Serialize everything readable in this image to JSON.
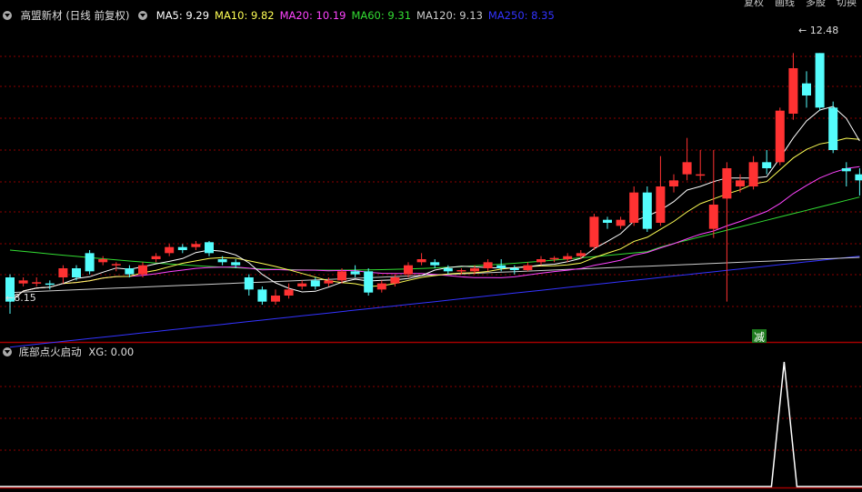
{
  "toolbar": {
    "right_buttons": [
      "复权",
      "画线",
      "多股",
      "切换"
    ]
  },
  "stock": {
    "name": "高盟新材",
    "period": "(日线 前复权)"
  },
  "ma_legend": [
    {
      "label": "MA5:",
      "value": "9.29",
      "color": "#ffffff"
    },
    {
      "label": "MA10:",
      "value": "9.82",
      "color": "#ffff55"
    },
    {
      "label": "MA20:",
      "value": "10.19",
      "color": "#ff44ff"
    },
    {
      "label": "MA60:",
      "value": "9.31",
      "color": "#33dd33"
    },
    {
      "label": "MA120:",
      "value": "9.13",
      "color": "#cccccc"
    },
    {
      "label": "MA250:",
      "value": "8.35",
      "color": "#3333ff"
    }
  ],
  "annotations": {
    "high_label": "12.48",
    "low_label": "8.15",
    "signal_badge": "减"
  },
  "indicator": {
    "name": "底部点火启动",
    "value_label": "XG: 0.00"
  },
  "colors": {
    "up": "#ff3232",
    "down": "#54fcfc",
    "grid": "#8b0000",
    "border": "#a00000"
  },
  "chart_data": {
    "type": "candlestick",
    "price_range": [
      7.9,
      13.0
    ],
    "candles": [
      [
        8.8,
        8.4,
        8.85,
        8.2
      ],
      [
        8.7,
        8.75,
        8.8,
        8.65
      ],
      [
        8.7,
        8.72,
        8.8,
        8.65
      ],
      [
        8.7,
        8.68,
        8.75,
        8.6
      ],
      [
        8.8,
        8.95,
        9.0,
        8.7
      ],
      [
        8.95,
        8.8,
        9.0,
        8.75
      ],
      [
        9.2,
        8.9,
        9.25,
        8.85
      ],
      [
        9.05,
        9.1,
        9.15,
        9.0
      ],
      [
        9.0,
        9.02,
        9.05,
        8.9
      ],
      [
        8.95,
        8.85,
        9.0,
        8.8
      ],
      [
        8.85,
        9.0,
        9.05,
        8.8
      ],
      [
        9.1,
        9.15,
        9.2,
        9.05
      ],
      [
        9.2,
        9.3,
        9.35,
        9.15
      ],
      [
        9.3,
        9.25,
        9.35,
        9.2
      ],
      [
        9.3,
        9.35,
        9.4,
        9.25
      ],
      [
        9.38,
        9.2,
        9.4,
        9.15
      ],
      [
        9.1,
        9.05,
        9.15,
        9.0
      ],
      [
        9.05,
        9.0,
        9.1,
        8.95
      ],
      [
        8.8,
        8.6,
        8.85,
        8.5
      ],
      [
        8.6,
        8.4,
        8.65,
        8.35
      ],
      [
        8.4,
        8.5,
        8.6,
        8.35
      ],
      [
        8.5,
        8.6,
        8.7,
        8.45
      ],
      [
        8.65,
        8.7,
        8.75,
        8.6
      ],
      [
        8.75,
        8.65,
        8.8,
        8.6
      ],
      [
        8.7,
        8.75,
        8.8,
        8.65
      ],
      [
        8.75,
        8.9,
        8.95,
        8.7
      ],
      [
        8.9,
        8.85,
        9.0,
        8.8
      ],
      [
        8.9,
        8.55,
        8.95,
        8.5
      ],
      [
        8.6,
        8.7,
        8.75,
        8.55
      ],
      [
        8.7,
        8.8,
        8.85,
        8.65
      ],
      [
        8.85,
        9.0,
        9.05,
        8.8
      ],
      [
        9.05,
        9.1,
        9.2,
        9.0
      ],
      [
        9.05,
        9.0,
        9.1,
        8.95
      ],
      [
        8.95,
        8.9,
        9.0,
        8.85
      ],
      [
        8.9,
        8.92,
        8.95,
        8.85
      ],
      [
        8.9,
        8.95,
        9.0,
        8.85
      ],
      [
        8.95,
        9.05,
        9.1,
        8.9
      ],
      [
        9.0,
        8.95,
        9.1,
        8.9
      ],
      [
        8.95,
        8.92,
        9.0,
        8.85
      ],
      [
        8.92,
        9.0,
        9.05,
        8.9
      ],
      [
        9.05,
        9.1,
        9.15,
        9.0
      ],
      [
        9.1,
        9.12,
        9.15,
        9.05
      ],
      [
        9.1,
        9.15,
        9.2,
        9.05
      ],
      [
        9.15,
        9.2,
        9.25,
        9.1
      ],
      [
        9.3,
        9.8,
        9.85,
        9.25
      ],
      [
        9.75,
        9.7,
        9.8,
        9.6
      ],
      [
        9.65,
        9.75,
        9.8,
        9.6
      ],
      [
        9.7,
        10.2,
        10.3,
        9.65
      ],
      [
        10.2,
        9.6,
        10.3,
        9.55
      ],
      [
        9.7,
        10.3,
        10.8,
        9.65
      ],
      [
        10.3,
        10.4,
        10.5,
        10.2
      ],
      [
        10.5,
        10.7,
        11.1,
        10.4
      ],
      [
        10.5,
        10.5,
        10.9,
        10.4
      ],
      [
        9.6,
        10.0,
        10.9,
        9.45
      ],
      [
        10.1,
        10.6,
        10.7,
        8.4
      ],
      [
        10.3,
        10.4,
        10.5,
        10.2
      ],
      [
        10.3,
        10.7,
        10.8,
        10.25
      ],
      [
        10.7,
        10.6,
        10.9,
        10.5
      ],
      [
        10.7,
        11.55,
        11.6,
        10.65
      ],
      [
        11.5,
        12.25,
        12.5,
        11.4
      ],
      [
        12.0,
        11.8,
        12.2,
        11.6
      ],
      [
        12.5,
        11.6,
        12.5,
        11.55
      ],
      [
        11.6,
        10.9,
        11.7,
        10.85
      ],
      [
        10.6,
        10.55,
        10.7,
        10.3
      ],
      [
        10.5,
        10.4,
        10.6,
        10.15
      ]
    ],
    "indicator_signal": {
      "index": 59,
      "value": 1
    }
  }
}
